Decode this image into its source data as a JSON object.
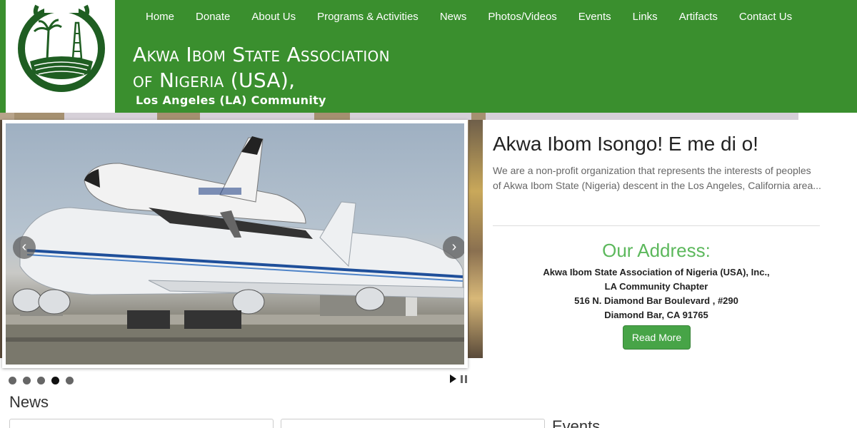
{
  "nav": [
    "Home",
    "Donate",
    "About Us",
    "Programs & Activities",
    "News",
    "Photos/Videos",
    "Events",
    "Links",
    "Artifacts",
    "Contact Us"
  ],
  "brand": {
    "line1": "Akwa Ibom State Association",
    "line2": "of Nigeria (USA),",
    "sub": "Los Angeles (LA) Community"
  },
  "slider": {
    "prev": "‹",
    "next": "›",
    "slide_count": 5,
    "active_slide": 4
  },
  "welcome": {
    "title": "Akwa Ibom Isongo! E me di o!",
    "text": "We are a non-profit organization that represents the interests of peoples of Akwa Ibom State (Nigeria) descent in the Los Angeles, California area..."
  },
  "address": {
    "title": "Our Address:",
    "lines": [
      "Akwa Ibom State Association of Nigeria (USA), Inc.,",
      "LA Community Chapter",
      "516 N. Diamond Bar Boulevard , #290",
      "Diamond Bar, CA 91765"
    ],
    "button": "Read More"
  },
  "sections": {
    "news": "News",
    "events": "Events"
  },
  "colors": {
    "header_green": "#3a8f2e",
    "accent_green": "#5cb85c",
    "button_green": "#47a447"
  }
}
